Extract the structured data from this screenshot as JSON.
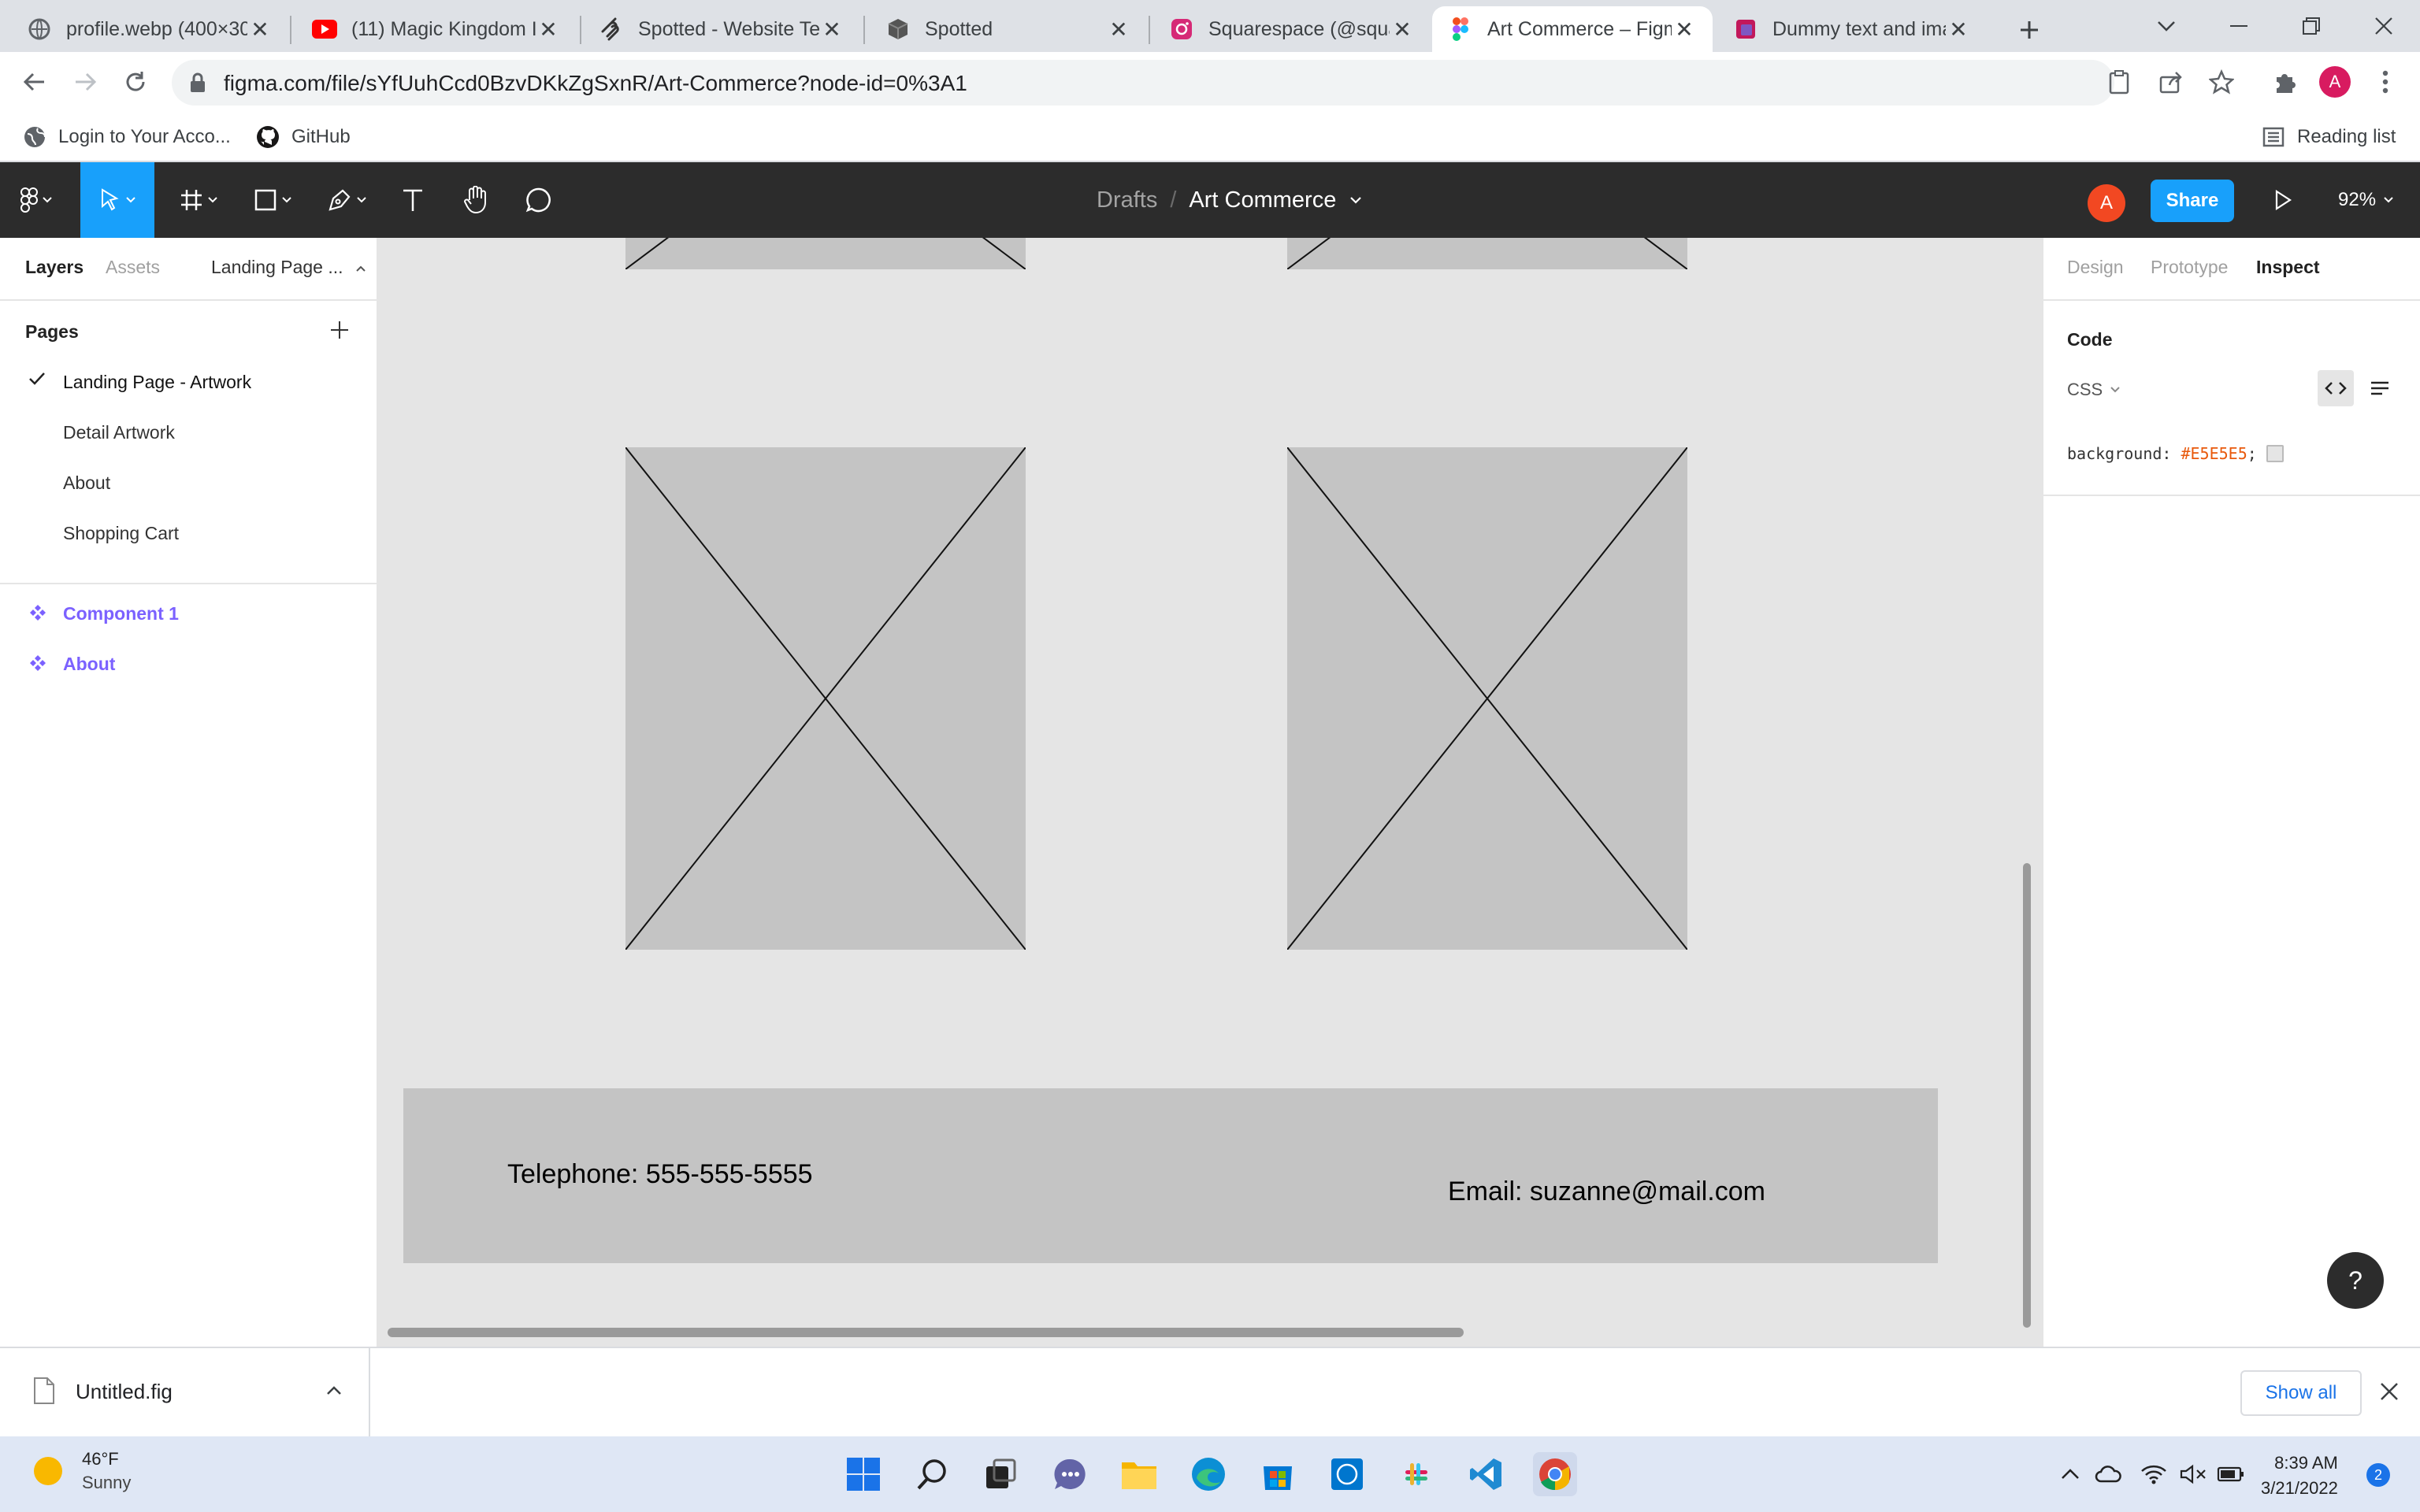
{
  "browser": {
    "tabs": [
      {
        "title": "profile.webp (400×30",
        "icon": "image-favicon",
        "active": false
      },
      {
        "title": "(11) Magic Kingdom I",
        "icon": "youtube-favicon",
        "active": false
      },
      {
        "title": "Spotted - Website Te",
        "icon": "squarespace-favicon",
        "active": false
      },
      {
        "title": "Spotted",
        "icon": "cube-favicon",
        "active": false
      },
      {
        "title": "Squarespace (@squar",
        "icon": "instagram-favicon",
        "active": false
      },
      {
        "title": "Art Commerce – Figm",
        "icon": "figma-favicon",
        "active": true
      },
      {
        "title": "Dummy text and imag",
        "icon": "dummy-favicon",
        "active": false
      }
    ],
    "url": "figma.com/file/sYfUuhCcd0BzvDKkZgSxnR/Art-Commerce?node-id=0%3A1",
    "profile_initial": "A",
    "bookmarks": [
      {
        "label": "Login to Your Acco...",
        "icon": "globe-icon"
      },
      {
        "label": "GitHub",
        "icon": "github-icon"
      }
    ],
    "reading_list": "Reading list"
  },
  "figma": {
    "breadcrumb": {
      "folder": "Drafts",
      "separator": "/",
      "file": "Art Commerce"
    },
    "avatar_initial": "A",
    "share_label": "Share",
    "zoom": "92%",
    "left_panel": {
      "tabs": {
        "layers": "Layers",
        "assets": "Assets",
        "page_selector": "Landing Page ..."
      },
      "pages_header": "Pages",
      "pages": [
        "Landing Page - Artwork",
        "Detail Artwork",
        "About",
        "Shopping Cart"
      ],
      "selected_page": "Landing Page - Artwork",
      "layers": [
        "Component 1",
        "About"
      ]
    },
    "canvas": {
      "background": "#E5E5E5",
      "placeholder_color": "#C4C4C4",
      "footer": {
        "telephone": "Telephone: 555-555-5555",
        "email": "Email: suzanne@mail.com"
      }
    },
    "right_panel": {
      "tabs": {
        "design": "Design",
        "prototype": "Prototype",
        "inspect": "Inspect"
      },
      "active_tab": "Inspect",
      "code_header": "Code",
      "language": "CSS",
      "code_property": "background:",
      "code_value": "#E5E5E5",
      "code_end": ";"
    },
    "help_label": "?"
  },
  "downloads": {
    "file": "Untitled.fig",
    "show_all": "Show all"
  },
  "taskbar": {
    "weather": {
      "temp": "46°F",
      "condition": "Sunny"
    },
    "time": "8:39 AM",
    "date": "3/21/2022",
    "notification_count": "2"
  },
  "colors": {
    "figma_blue": "#18a0fb",
    "figma_purple": "#7b61ff",
    "toolbar_dark": "#2c2c2c"
  }
}
